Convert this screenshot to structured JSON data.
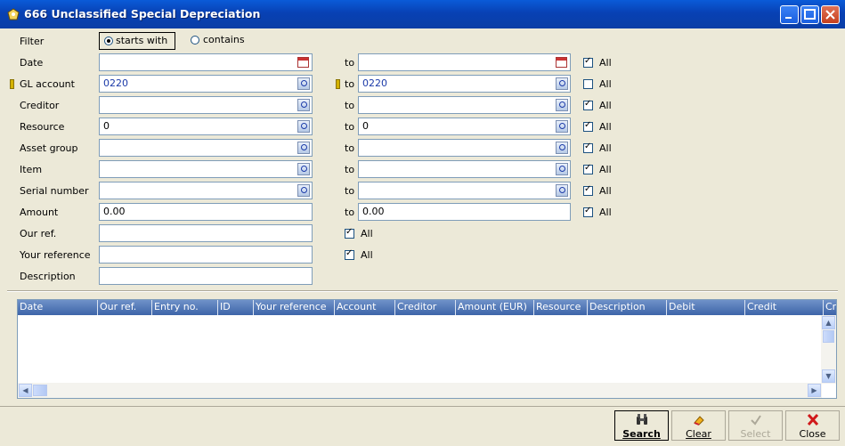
{
  "window": {
    "title": "666 Unclassified Special Depreciation"
  },
  "filter": {
    "label": "Filter",
    "option_starts": "starts with",
    "option_contains": "contains"
  },
  "fields": {
    "date": {
      "label": "Date",
      "from": "",
      "to": "",
      "all": "All"
    },
    "gl_account": {
      "label": "GL account",
      "from": "0220",
      "to": "0220",
      "all": "All"
    },
    "creditor": {
      "label": "Creditor",
      "from": "",
      "to": "",
      "all": "All"
    },
    "resource": {
      "label": "Resource",
      "from": "0",
      "to": "0",
      "all": "All"
    },
    "asset_group": {
      "label": "Asset group",
      "from": "",
      "to": "",
      "all": "All"
    },
    "item": {
      "label": "Item",
      "from": "",
      "to": "",
      "all": "All"
    },
    "serial_number": {
      "label": "Serial number",
      "from": "",
      "to": "",
      "all": "All"
    },
    "amount": {
      "label": "Amount",
      "from": "0.00",
      "to": "0.00",
      "all": "All"
    },
    "our_ref": {
      "label": "Our ref.",
      "value": "",
      "all": "All"
    },
    "your_reference": {
      "label": "Your reference",
      "value": "",
      "all": "All"
    },
    "description": {
      "label": "Description",
      "value": ""
    }
  },
  "to_label": "to",
  "grid": {
    "columns": [
      "Date",
      "Our ref.",
      "Entry no.",
      "ID",
      "Your reference",
      "Account",
      "Creditor",
      "Amount (EUR)",
      "Resource",
      "Description",
      "Debit",
      "Credit",
      "Cr"
    ]
  },
  "buttons": {
    "search": "Search",
    "clear": "Clear",
    "select": "Select",
    "close": "Close"
  }
}
